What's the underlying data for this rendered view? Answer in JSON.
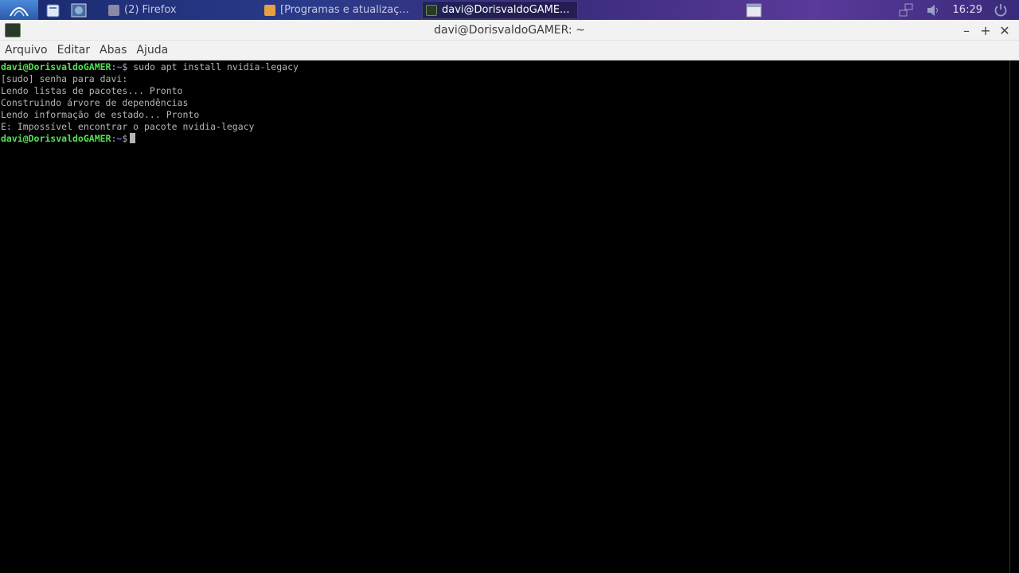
{
  "taskbar": {
    "tasks": [
      {
        "label": "(2) Firefox"
      },
      {
        "label": "[Programas e atualizaç..."
      },
      {
        "label": "davi@DorisvaldoGAME..."
      }
    ],
    "clock": "16:29"
  },
  "window": {
    "title": "davi@DorisvaldoGAMER: ~",
    "controls": {
      "minimize": "–",
      "maximize": "+",
      "close": "✕"
    }
  },
  "menubar": {
    "items": [
      "Arquivo",
      "Editar",
      "Abas",
      "Ajuda"
    ]
  },
  "terminal": {
    "lines": [
      {
        "user": "davi@DorisvaldoGAMER",
        "sep": ":",
        "path": "~",
        "dollar": "$ ",
        "cmd": "sudo apt install nvidia-legacy"
      },
      {
        "text": "[sudo] senha para davi:"
      },
      {
        "text": "Lendo listas de pacotes... Pronto"
      },
      {
        "text": "Construindo árvore de dependências"
      },
      {
        "text": "Lendo informação de estado... Pronto"
      },
      {
        "text": "E: Impossível encontrar o pacote nvidia-legacy"
      },
      {
        "user": "davi@DorisvaldoGAMER",
        "sep": ":",
        "path": "~",
        "dollar": "$"
      }
    ]
  },
  "colors": {
    "prompt_user": "#54e054",
    "prompt_path": "#5a78ff",
    "terminal_text": "#b4b4b4",
    "terminal_bg": "#000000"
  },
  "icons": {
    "start": "distro-logo-icon",
    "launcher1": "file-manager-icon",
    "launcher2": "network-icon",
    "tray": [
      "window-icon",
      "network-tray-icon",
      "volume-icon",
      "power-icon"
    ]
  }
}
